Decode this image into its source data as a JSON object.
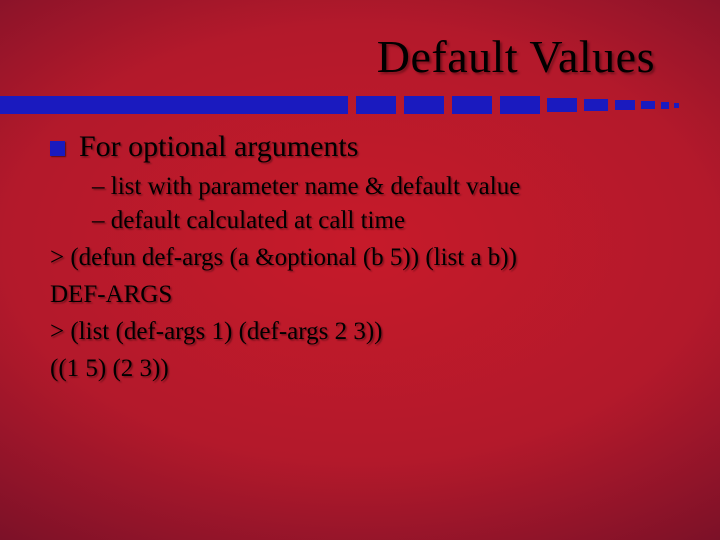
{
  "title": "Default Values",
  "bullet": "For optional arguments",
  "sub1": "– list with parameter name & default value",
  "sub2": "– default calculated at call time",
  "code1": "> (defun def-args (a &optional (b 5))   (list a b))",
  "code2": "DEF-ARGS",
  "code3": "> (list (def-args 1) (def-args 2 3))",
  "code4": "((1 5) (2 3))"
}
